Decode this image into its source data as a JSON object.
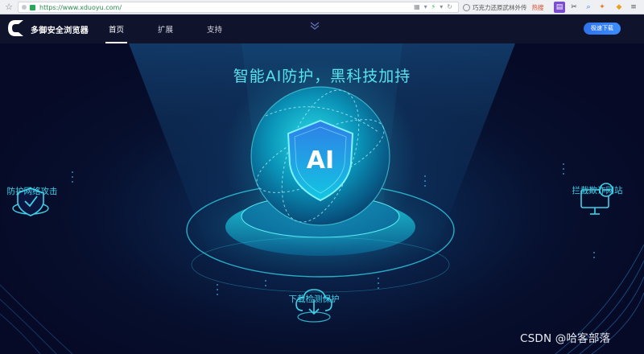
{
  "browser": {
    "url": "https://www.xduoyu.com/",
    "search_query": "巧克力还原武林外传",
    "search_hot": "热搜"
  },
  "nav": {
    "brand": "多御安全浏览器",
    "links": [
      "首页",
      "扩展",
      "支持"
    ],
    "active_index": 0,
    "download_button": "极速下载"
  },
  "hero": {
    "headline": "智能AI防护，黑科技加持",
    "orb_label": "AI",
    "features": {
      "left": "防护网络攻击",
      "right": "拦截欺诈网站",
      "bottom": "下载检测保护"
    }
  },
  "watermark": "CSDN @哈客部落",
  "colors": {
    "accent_cyan": "#3fd2ea",
    "nav_bg": "#10132c",
    "button_blue": "#2f73ea"
  }
}
